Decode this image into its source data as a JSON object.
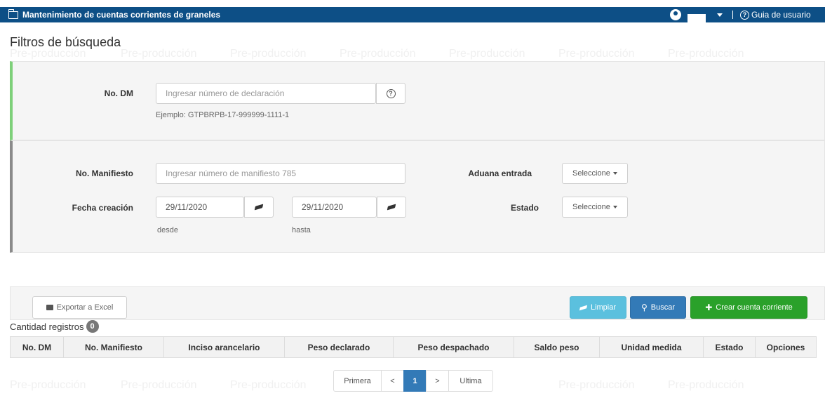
{
  "header": {
    "title": "Mantenimiento de cuentas corrientes de graneles",
    "guide_label": "Guia de usuario"
  },
  "page_title": "Filtros de búsqueda",
  "watermark_text": "Pre-producción",
  "filters": {
    "dm": {
      "label": "No. DM",
      "placeholder": "Ingresar número de declaración",
      "hint": "Ejemplo: GTPBRPB-17-999999-1111-1"
    },
    "manifiesto": {
      "label": "No. Manifiesto",
      "placeholder": "Ingresar número de manifiesto 785"
    },
    "fecha": {
      "label": "Fecha creación",
      "from_value": "29/11/2020",
      "to_value": "29/11/2020",
      "from_hint": "desde",
      "to_hint": "hasta"
    },
    "aduana": {
      "label": "Aduana entrada",
      "selected": "Seleccione"
    },
    "estado": {
      "label": "Estado",
      "selected": "Seleccione"
    }
  },
  "actions": {
    "export_label": "Exportar a Excel",
    "clear_label": "Limpiar",
    "search_label": "Buscar",
    "create_label": "Crear cuenta corriente"
  },
  "results": {
    "count_label": "Cantidad registros",
    "count": "0"
  },
  "table": {
    "columns": [
      "No. DM",
      "No. Manifiesto",
      "Inciso arancelario",
      "Peso declarado",
      "Peso despachado",
      "Saldo peso",
      "Unidad medida",
      "Estado",
      "Opciones"
    ]
  },
  "pagination": {
    "first": "Primera",
    "prev": "<",
    "current": "1",
    "next": ">",
    "last": "Ultima"
  },
  "colors": {
    "header_bg": "#0d4f86",
    "panel_accent_green": "#7ed07a",
    "panel_accent_gray": "#8a8a8a",
    "btn_info": "#5bc0de",
    "btn_primary": "#337ab7",
    "btn_success": "#2aa12a"
  }
}
